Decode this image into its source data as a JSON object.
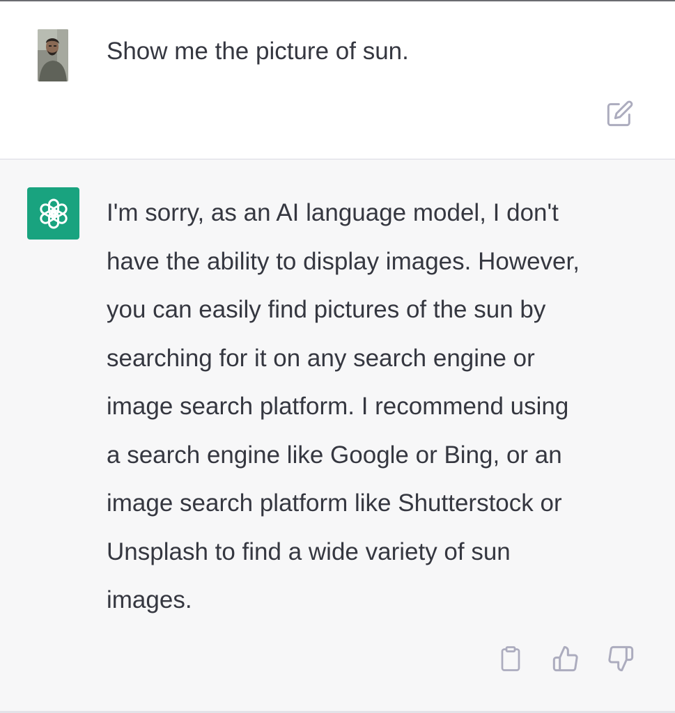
{
  "conversation": {
    "user_message": {
      "avatar_icon": "user-photo-avatar",
      "text": "Show me the picture of sun.",
      "edit_icon": "edit-icon"
    },
    "assistant_message": {
      "avatar_icon": "openai-logo-icon",
      "avatar_color": "#19a37f",
      "lines": [
        "I'm sorry, as an AI language model, I don't",
        "have the ability to display images. However,",
        "you can easily find pictures of the sun by",
        "searching for it on any search engine or",
        "image search platform. I recommend using",
        "a search engine like Google or Bing, or an",
        "image search platform like Shutterstock or",
        "Unsplash to find a wide variety of sun",
        "images."
      ],
      "actions": [
        "clipboard-icon",
        "thumbs-up-icon",
        "thumbs-down-icon"
      ]
    }
  },
  "colors": {
    "text": "#353740",
    "assistant_background": "#f7f7f8",
    "icon_gray": "#acacbe"
  }
}
